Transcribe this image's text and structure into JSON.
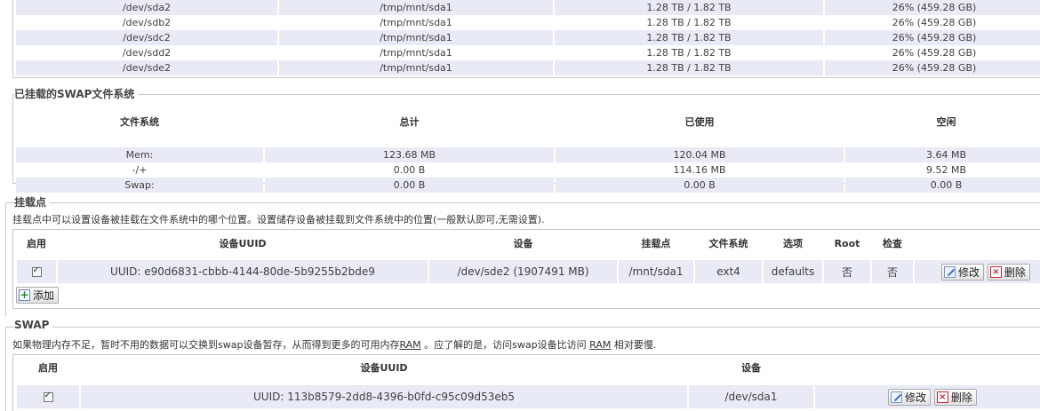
{
  "mounted_fs": {
    "rows": [
      [
        "/dev/sda2",
        "/tmp/mnt/sda1",
        "1.28 TB / 1.82 TB",
        "26% (459.28 GB)"
      ],
      [
        "/dev/sdb2",
        "/tmp/mnt/sda1",
        "1.28 TB / 1.82 TB",
        "26% (459.28 GB)"
      ],
      [
        "/dev/sdc2",
        "/tmp/mnt/sda1",
        "1.28 TB / 1.82 TB",
        "26% (459.28 GB)"
      ],
      [
        "/dev/sdd2",
        "/tmp/mnt/sda1",
        "1.28 TB / 1.82 TB",
        "26% (459.28 GB)"
      ],
      [
        "/dev/sde2",
        "/tmp/mnt/sda1",
        "1.28 TB / 1.82 TB",
        "26% (459.28 GB)"
      ]
    ]
  },
  "swap_fs": {
    "legend": "已挂载的SWAP文件系统",
    "headers": [
      "文件系统",
      "总计",
      "已使用",
      "空闲"
    ],
    "rows": [
      [
        "Mem:",
        "123.68 MB",
        "120.04 MB",
        "3.64 MB"
      ],
      [
        "-/+",
        "0.00 B",
        "114.16 MB",
        "9.52 MB"
      ],
      [
        "Swap:",
        "0.00 B",
        "0.00 B",
        "0.00 B"
      ]
    ]
  },
  "mount_points": {
    "legend": "挂载点",
    "description": "挂载点中可以设置设备被挂载在文件系统中的哪个位置。设置储存设备被挂载到文件系统中的位置(一般默认即可,无需设置).",
    "headers": [
      "启用",
      "设备UUID",
      "设备",
      "挂载点",
      "文件系统",
      "选项",
      "Root",
      "检查"
    ],
    "row": {
      "uuid": "UUID: e90d6831-cbbb-4144-80de-5b9255b2bde9",
      "device": "/dev/sde2 (1907491 MB)",
      "mount": "/mnt/sda1",
      "fs": "ext4",
      "options": "defaults",
      "root": "否",
      "check": "否"
    },
    "edit_label": "修改",
    "delete_label": "删除",
    "add_label": "添加"
  },
  "swap": {
    "legend": "SWAP",
    "desc_part1": "如果物理内存不足，暂时不用的数据可以交换到swap设备暂存，从而得到更多的可用内存",
    "desc_ram1": "RAM",
    "desc_part2": "。应了解的是，访问swap设备比访问",
    "desc_ram2": "RAM",
    "desc_part3": "相对要慢.",
    "headers": [
      "启用",
      "设备UUID",
      "设备"
    ],
    "row": {
      "uuid": "UUID: 113b8579-2dd8-4396-b0fd-c95c09d53eb5",
      "device": "/dev/sda1"
    },
    "edit_label": "修改",
    "delete_label": "删除"
  },
  "icons": {
    "checkbox": "checkbox-checked-icon",
    "edit": "edit-icon",
    "delete": "delete-icon",
    "add": "add-icon"
  }
}
